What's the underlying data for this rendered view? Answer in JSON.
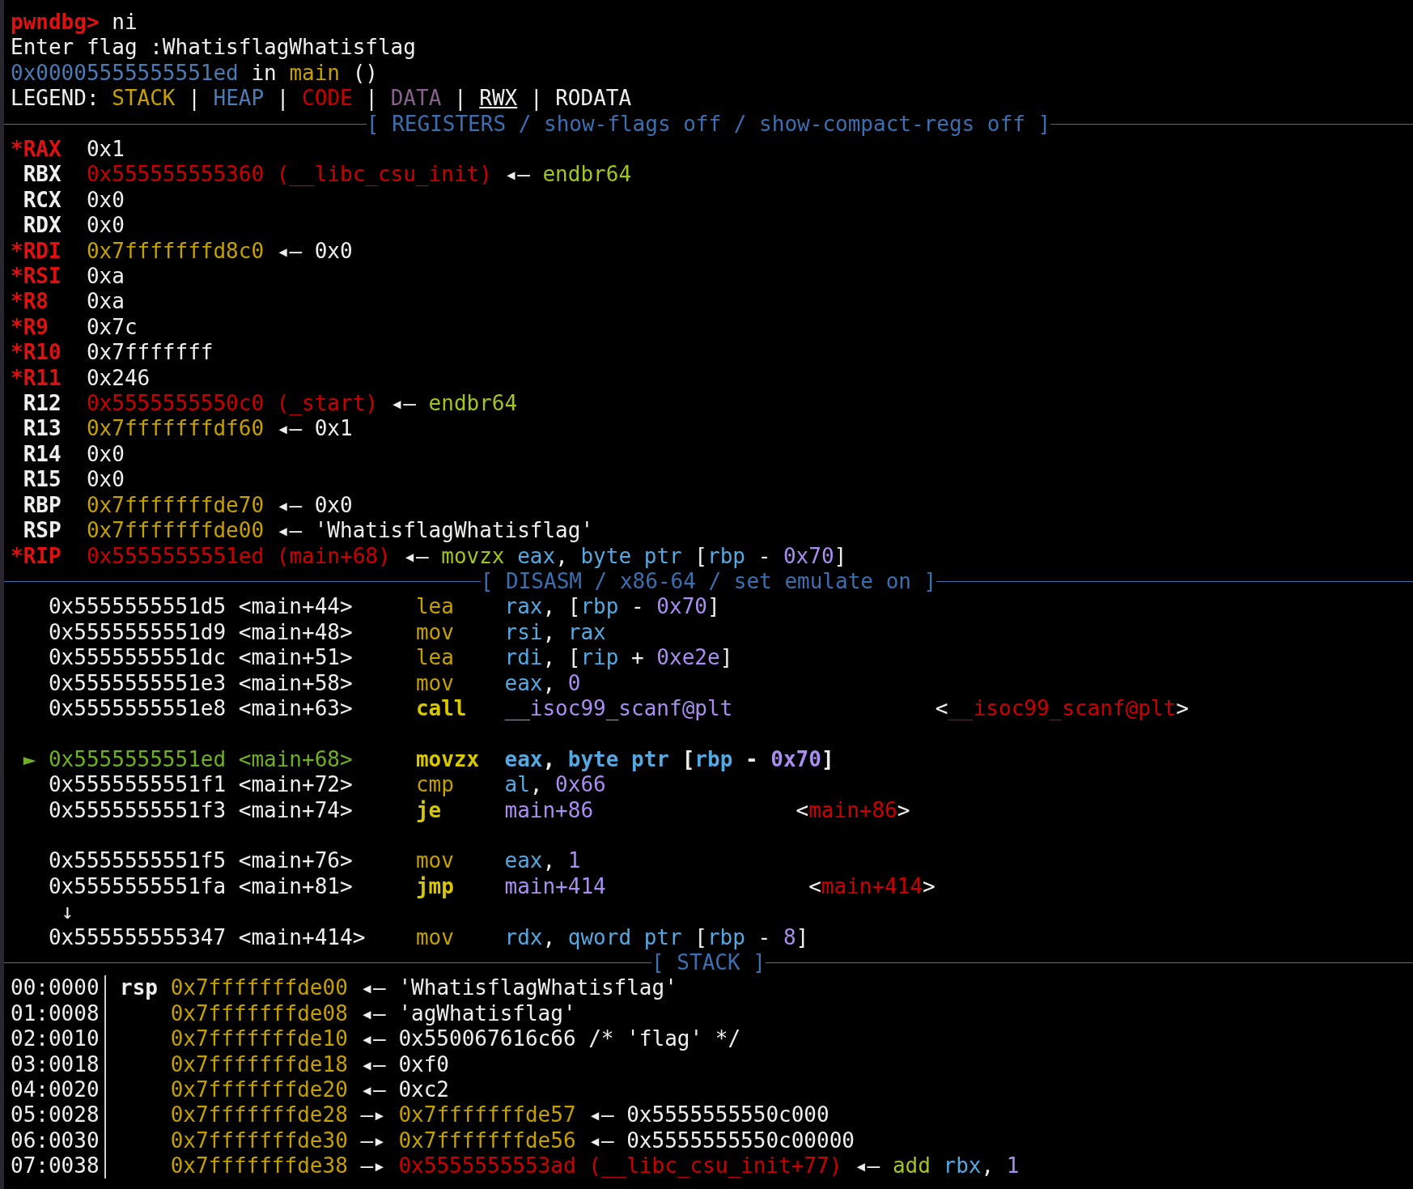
{
  "lines": [
    {
      "kind": "text",
      "segments": [
        {
          "text": "pwndbg> ",
          "color": "#dd1111",
          "bold": true
        },
        {
          "text": "ni"
        }
      ]
    },
    {
      "kind": "text",
      "segments": [
        {
          "text": "Enter flag :WhatisflagWhatisflag"
        }
      ]
    },
    {
      "kind": "text",
      "segments": [
        {
          "text": "0x00005555555551ed",
          "color": "#4a7bb5"
        },
        {
          "text": " in "
        },
        {
          "text": "main",
          "color": "#c4a000"
        },
        {
          "text": " ()"
        }
      ]
    },
    {
      "kind": "text",
      "segments": [
        {
          "text": "LEGEND: "
        },
        {
          "text": "STACK",
          "color": "#c4a000"
        },
        {
          "text": " | "
        },
        {
          "text": "HEAP",
          "color": "#4a7bb5"
        },
        {
          "text": " | "
        },
        {
          "text": "CODE",
          "color": "#cc0000"
        },
        {
          "text": " | "
        },
        {
          "text": "DATA",
          "color": "#85608b"
        },
        {
          "text": " | "
        },
        {
          "text": "RWX",
          "underline": true
        },
        {
          "text": " | RODATA"
        }
      ]
    },
    {
      "kind": "rule",
      "title": "[ REGISTERS / show-flags off / show-compact-regs off ]"
    },
    {
      "kind": "text",
      "segments": [
        {
          "text": "*RAX",
          "color": "#dd1111",
          "bold": true
        },
        {
          "text": "  0x1"
        }
      ]
    },
    {
      "kind": "text",
      "segments": [
        {
          "text": " RBX",
          "bold": true
        },
        {
          "text": "  0x555555555360 (__libc_csu_init)",
          "color": "#cc0000"
        },
        {
          "text": " ◂— "
        },
        {
          "text": "endbr64",
          "color": "#a0c420"
        }
      ]
    },
    {
      "kind": "text",
      "segments": [
        {
          "text": " RCX",
          "bold": true
        },
        {
          "text": "  0x0"
        }
      ]
    },
    {
      "kind": "text",
      "segments": [
        {
          "text": " RDX",
          "bold": true
        },
        {
          "text": "  0x0"
        }
      ]
    },
    {
      "kind": "text",
      "segments": [
        {
          "text": "*RDI",
          "color": "#dd1111",
          "bold": true
        },
        {
          "text": "  0x7fffffffd8c0",
          "color": "#c4a000"
        },
        {
          "text": " ◂— 0x0"
        }
      ]
    },
    {
      "kind": "text",
      "segments": [
        {
          "text": "*RSI",
          "color": "#dd1111",
          "bold": true
        },
        {
          "text": "  0xa"
        }
      ]
    },
    {
      "kind": "text",
      "segments": [
        {
          "text": "*R8",
          "color": "#dd1111",
          "bold": true
        },
        {
          "text": "   0xa"
        }
      ]
    },
    {
      "kind": "text",
      "segments": [
        {
          "text": "*R9",
          "color": "#dd1111",
          "bold": true
        },
        {
          "text": "   0x7c"
        }
      ]
    },
    {
      "kind": "text",
      "segments": [
        {
          "text": "*R10",
          "color": "#dd1111",
          "bold": true
        },
        {
          "text": "  0x7fffffff"
        }
      ]
    },
    {
      "kind": "text",
      "segments": [
        {
          "text": "*R11",
          "color": "#dd1111",
          "bold": true
        },
        {
          "text": "  0x246"
        }
      ]
    },
    {
      "kind": "text",
      "segments": [
        {
          "text": " R12",
          "bold": true
        },
        {
          "text": "  0x5555555550c0 (_start)",
          "color": "#cc0000"
        },
        {
          "text": " ◂— "
        },
        {
          "text": "endbr64",
          "color": "#a0c420"
        }
      ]
    },
    {
      "kind": "text",
      "segments": [
        {
          "text": " R13",
          "bold": true
        },
        {
          "text": "  0x7fffffffdf60",
          "color": "#c4a000"
        },
        {
          "text": " ◂— 0x1"
        }
      ]
    },
    {
      "kind": "text",
      "segments": [
        {
          "text": " R14",
          "bold": true
        },
        {
          "text": "  0x0"
        }
      ]
    },
    {
      "kind": "text",
      "segments": [
        {
          "text": " R15",
          "bold": true
        },
        {
          "text": "  0x0"
        }
      ]
    },
    {
      "kind": "text",
      "segments": [
        {
          "text": " RBP",
          "bold": true
        },
        {
          "text": "  0x7fffffffde70",
          "color": "#c4a000"
        },
        {
          "text": " ◂— 0x0"
        }
      ]
    },
    {
      "kind": "text",
      "segments": [
        {
          "text": " RSP",
          "bold": true
        },
        {
          "text": "  0x7fffffffde00",
          "color": "#c4a000"
        },
        {
          "text": " ◂— 'WhatisflagWhatisflag'"
        }
      ]
    },
    {
      "kind": "text",
      "segments": [
        {
          "text": "*RIP",
          "color": "#dd1111",
          "bold": true
        },
        {
          "text": "  0x5555555551ed (main+68)",
          "color": "#cc0000"
        },
        {
          "text": " ◂— "
        },
        {
          "text": "movzx",
          "color": "#a0c420"
        },
        {
          "text": " eax",
          "color": "#56a8e0"
        },
        {
          "text": ", "
        },
        {
          "text": "byte ptr",
          "color": "#56a8e0"
        },
        {
          "text": " ["
        },
        {
          "text": "rbp",
          "color": "#56a8e0"
        },
        {
          "text": " - "
        },
        {
          "text": "0x70",
          "color": "#a98ef0"
        },
        {
          "text": "]"
        }
      ]
    },
    {
      "kind": "rule",
      "title": "[ DISASM / x86-64 / set emulate on ]"
    },
    {
      "kind": "text",
      "segments": [
        {
          "text": "   0x5555555551d5 <main+44>     "
        },
        {
          "text": "lea",
          "color": "#c4a000"
        },
        {
          "text": "    rax",
          "color": "#56a8e0"
        },
        {
          "text": ", ["
        },
        {
          "text": "rbp",
          "color": "#56a8e0"
        },
        {
          "text": " - "
        },
        {
          "text": "0x70",
          "color": "#a98ef0"
        },
        {
          "text": "]"
        }
      ]
    },
    {
      "kind": "text",
      "segments": [
        {
          "text": "   0x5555555551d9 <main+48>     "
        },
        {
          "text": "mov",
          "color": "#c4a000"
        },
        {
          "text": "    rsi",
          "color": "#56a8e0"
        },
        {
          "text": ", "
        },
        {
          "text": "rax",
          "color": "#56a8e0"
        }
      ]
    },
    {
      "kind": "text",
      "segments": [
        {
          "text": "   0x5555555551dc <main+51>     "
        },
        {
          "text": "lea",
          "color": "#c4a000"
        },
        {
          "text": "    rdi",
          "color": "#56a8e0"
        },
        {
          "text": ", ["
        },
        {
          "text": "rip",
          "color": "#56a8e0"
        },
        {
          "text": " + "
        },
        {
          "text": "0xe2e",
          "color": "#a98ef0"
        },
        {
          "text": "]"
        }
      ]
    },
    {
      "kind": "text",
      "segments": [
        {
          "text": "   0x5555555551e3 <main+58>     "
        },
        {
          "text": "mov",
          "color": "#c4a000"
        },
        {
          "text": "    eax",
          "color": "#56a8e0"
        },
        {
          "text": ", "
        },
        {
          "text": "0",
          "color": "#a98ef0"
        }
      ]
    },
    {
      "kind": "text",
      "segments": [
        {
          "text": "   0x5555555551e8 <main+63>     "
        },
        {
          "text": "call",
          "color": "#d8c800",
          "bold": true
        },
        {
          "text": "   __isoc99_scanf@plt",
          "color": "#a98ef0"
        },
        {
          "text": "                <"
        },
        {
          "text": "__isoc99_scanf@plt",
          "color": "#cc0000"
        },
        {
          "text": ">"
        }
      ]
    },
    {
      "kind": "blank"
    },
    {
      "kind": "text",
      "segments": [
        {
          "text": " ► 0x5555555551ed <main+68>",
          "color": "#6fb021"
        },
        {
          "text": "     movzx",
          "color": "#d8c800",
          "bold": true
        },
        {
          "text": "  eax",
          "color": "#56a8e0",
          "bold": true
        },
        {
          "text": ", ",
          "bold": true
        },
        {
          "text": "byte ptr",
          "color": "#56a8e0",
          "bold": true
        },
        {
          "text": " [",
          "bold": true
        },
        {
          "text": "rbp",
          "color": "#56a8e0",
          "bold": true
        },
        {
          "text": " - ",
          "bold": true
        },
        {
          "text": "0x70",
          "color": "#a98ef0",
          "bold": true
        },
        {
          "text": "]",
          "bold": true
        }
      ]
    },
    {
      "kind": "text",
      "segments": [
        {
          "text": "   0x5555555551f1 <main+72>     "
        },
        {
          "text": "cmp",
          "color": "#c4a000"
        },
        {
          "text": "    al",
          "color": "#56a8e0"
        },
        {
          "text": ", "
        },
        {
          "text": "0x66",
          "color": "#a98ef0"
        }
      ]
    },
    {
      "kind": "text",
      "segments": [
        {
          "text": "   0x5555555551f3 <main+74>     "
        },
        {
          "text": "je",
          "color": "#d8c800",
          "bold": true
        },
        {
          "text": "     main+86",
          "color": "#a98ef0"
        },
        {
          "text": "                <"
        },
        {
          "text": "main+86",
          "color": "#cc0000"
        },
        {
          "text": ">"
        }
      ]
    },
    {
      "kind": "blank"
    },
    {
      "kind": "text",
      "segments": [
        {
          "text": "   0x5555555551f5 <main+76>     "
        },
        {
          "text": "mov",
          "color": "#c4a000"
        },
        {
          "text": "    eax",
          "color": "#56a8e0"
        },
        {
          "text": ", "
        },
        {
          "text": "1",
          "color": "#a98ef0"
        }
      ]
    },
    {
      "kind": "text",
      "segments": [
        {
          "text": "   0x5555555551fa <main+81>     "
        },
        {
          "text": "jmp",
          "color": "#d8c800",
          "bold": true
        },
        {
          "text": "    main+414",
          "color": "#a98ef0"
        },
        {
          "text": "                <"
        },
        {
          "text": "main+414",
          "color": "#cc0000"
        },
        {
          "text": ">"
        }
      ]
    },
    {
      "kind": "text",
      "segments": [
        {
          "text": "    ↓"
        }
      ]
    },
    {
      "kind": "text",
      "segments": [
        {
          "text": "   0x555555555347 <main+414>    "
        },
        {
          "text": "mov",
          "color": "#c4a000"
        },
        {
          "text": "    rdx",
          "color": "#56a8e0"
        },
        {
          "text": ", "
        },
        {
          "text": "qword ptr",
          "color": "#56a8e0"
        },
        {
          "text": " ["
        },
        {
          "text": "rbp",
          "color": "#56a8e0"
        },
        {
          "text": " - "
        },
        {
          "text": "8",
          "color": "#a98ef0"
        },
        {
          "text": "]"
        }
      ]
    },
    {
      "kind": "rule",
      "title": "[ STACK ]"
    },
    {
      "kind": "stack",
      "offset": "00:0000",
      "segments": [
        {
          "text": " rsp",
          "bold": true
        },
        {
          "text": " 0x7fffffffde00",
          "color": "#c4a000"
        },
        {
          "text": " ◂— 'WhatisflagWhatisflag'"
        }
      ]
    },
    {
      "kind": "stack",
      "offset": "01:0008",
      "segments": [
        {
          "text": "     0x7fffffffde08",
          "color": "#c4a000"
        },
        {
          "text": " ◂— 'agWhatisflag'"
        }
      ]
    },
    {
      "kind": "stack",
      "offset": "02:0010",
      "segments": [
        {
          "text": "     0x7fffffffde10",
          "color": "#c4a000"
        },
        {
          "text": " ◂— 0x550067616c66 /* 'flag' */"
        }
      ]
    },
    {
      "kind": "stack",
      "offset": "03:0018",
      "segments": [
        {
          "text": "     0x7fffffffde18",
          "color": "#c4a000"
        },
        {
          "text": " ◂— 0xf0"
        }
      ]
    },
    {
      "kind": "stack",
      "offset": "04:0020",
      "segments": [
        {
          "text": "     0x7fffffffde20",
          "color": "#c4a000"
        },
        {
          "text": " ◂— 0xc2"
        }
      ]
    },
    {
      "kind": "stack",
      "offset": "05:0028",
      "segments": [
        {
          "text": "     0x7fffffffde28",
          "color": "#c4a000"
        },
        {
          "text": " —▸ "
        },
        {
          "text": "0x7fffffffde57",
          "color": "#c4a000"
        },
        {
          "text": " ◂— 0x5555555550c000"
        }
      ]
    },
    {
      "kind": "stack",
      "offset": "06:0030",
      "segments": [
        {
          "text": "     0x7fffffffde30",
          "color": "#c4a000"
        },
        {
          "text": " —▸ "
        },
        {
          "text": "0x7fffffffde56",
          "color": "#c4a000"
        },
        {
          "text": " ◂— 0x5555555550c00000"
        }
      ]
    },
    {
      "kind": "stack",
      "offset": "07:0038",
      "segments": [
        {
          "text": "     0x7fffffffde38",
          "color": "#c4a000"
        },
        {
          "text": " —▸ "
        },
        {
          "text": "0x5555555553ad (__libc_csu_init+77)",
          "color": "#cc0000"
        },
        {
          "text": " ◂— "
        },
        {
          "text": "add",
          "color": "#a0c420"
        },
        {
          "text": " rbx",
          "color": "#56a8e0"
        },
        {
          "text": ", "
        },
        {
          "text": "1",
          "color": "#a98ef0"
        }
      ]
    }
  ]
}
